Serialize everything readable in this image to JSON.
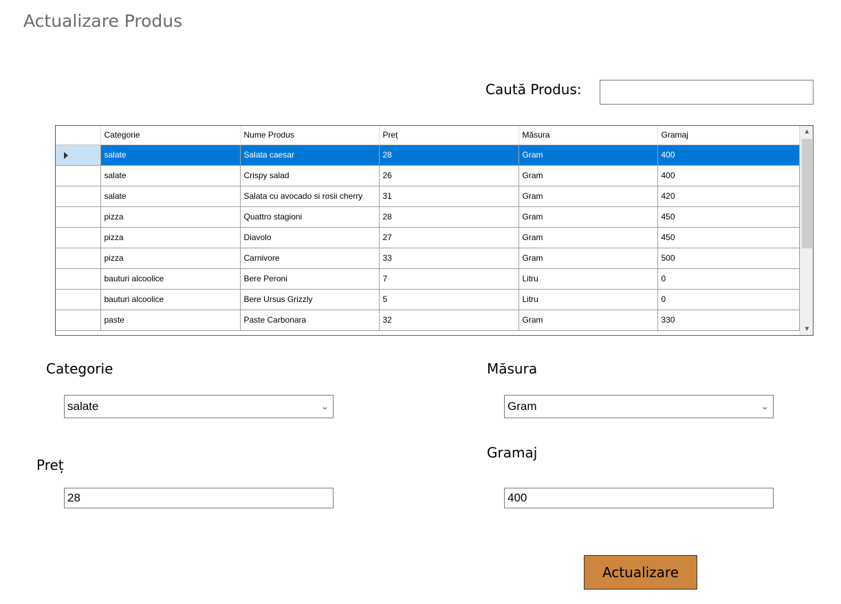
{
  "window": {
    "title": "Actualizare Produs"
  },
  "search": {
    "label": "Caută Produs:",
    "value": "",
    "placeholder": ""
  },
  "grid": {
    "columns": [
      "Categorie",
      "Nume Produs",
      "Preț",
      "Măsura",
      "Gramaj"
    ],
    "rows": [
      {
        "categorie": "salate",
        "nume": "Salata caesar",
        "pret": "28",
        "masura": "Gram",
        "gramaj": "400"
      },
      {
        "categorie": "salate",
        "nume": "Crispy salad",
        "pret": "26",
        "masura": "Gram",
        "gramaj": "400"
      },
      {
        "categorie": "salate",
        "nume": "Salata cu avocado si rosii cherry",
        "pret": "31",
        "masura": "Gram",
        "gramaj": "420"
      },
      {
        "categorie": "pizza",
        "nume": "Quattro stagioni",
        "pret": "28",
        "masura": "Gram",
        "gramaj": "450"
      },
      {
        "categorie": "pizza",
        "nume": "Diavolo",
        "pret": "27",
        "masura": "Gram",
        "gramaj": "450"
      },
      {
        "categorie": "pizza",
        "nume": "Carnivore",
        "pret": "33",
        "masura": "Gram",
        "gramaj": "500"
      },
      {
        "categorie": "bauturi alcoolice",
        "nume": "Bere Peroni",
        "pret": "7",
        "masura": "Litru",
        "gramaj": "0"
      },
      {
        "categorie": "bauturi alcoolice",
        "nume": "Bere Ursus Grizzly",
        "pret": "5",
        "masura": "Litru",
        "gramaj": "0"
      },
      {
        "categorie": "paste",
        "nume": "Paste Carbonara",
        "pret": "32",
        "masura": "Gram",
        "gramaj": "330"
      }
    ],
    "selected_row": 0
  },
  "form": {
    "categorie_label": "Categorie",
    "categorie_value": "salate",
    "masura_label": "Măsura",
    "masura_value": "Gram",
    "pret_label": "Preț",
    "pret_value": "28",
    "gramaj_label": "Gramaj",
    "gramaj_value": "400"
  },
  "actions": {
    "update_label": "Actualizare"
  },
  "colors": {
    "selection": "#0078d7",
    "button": "#cd853f",
    "title": "#6b6b6b"
  },
  "icons": {
    "row_indicator": "triangle-right-icon",
    "dropdown": "chevron-down-icon",
    "scroll_up": "chevron-up-icon",
    "scroll_down": "chevron-down-icon"
  }
}
